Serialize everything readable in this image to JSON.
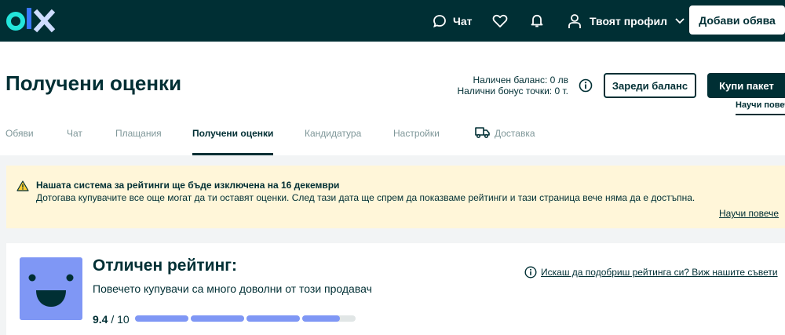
{
  "nav": {
    "chat_label": "Чат",
    "profile_label": "Твоят профил",
    "post_ad_label": "Добави обява"
  },
  "header": {
    "title": "Получени оценки",
    "balance_line": "Наличен баланс: 0 лв",
    "bonus_line": "Налични бонус точки: 0 т.",
    "topup_label": "Зареди баланс",
    "buy_label": "Купи пакет",
    "learn_more_label": "Научи повече"
  },
  "tabs": [
    {
      "label": "Обяви"
    },
    {
      "label": "Чат"
    },
    {
      "label": "Плащания"
    },
    {
      "label": "Получени оценки"
    },
    {
      "label": "Кандидатура"
    },
    {
      "label": "Настройки"
    },
    {
      "label": "Доставка"
    }
  ],
  "notice": {
    "title": "Нашата система за рейтинги ще бъде изключена на 16 декември",
    "text": "Дотогава купувачите все още могат да ти оставят оценки. След тази дата ще спрем да показваме рейтинги и тази страница вече няма да е достъпна.",
    "link_label": "Научи повече"
  },
  "rating": {
    "title": "Отличен рейтинг:",
    "subtitle": "Повечето купувачи са много доволни от този продавач",
    "score": "9.4",
    "max": "/ 10",
    "segments": [
      1,
      1,
      1,
      0.7
    ],
    "tip_label": "Искаш да подобриш рейтинга си? Виж нашите съвети"
  },
  "colors": {
    "brand": "#002f34",
    "accent": "#7f97f5",
    "notice_bg": "#fff6d9"
  }
}
